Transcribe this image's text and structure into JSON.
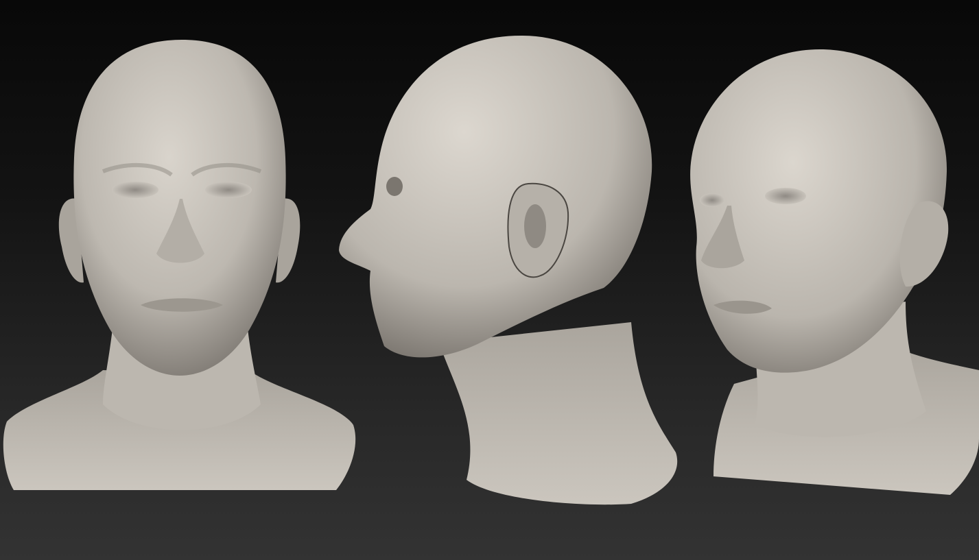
{
  "scene": {
    "background_color": "#1a1a1a",
    "material_color": "#c9c4bc",
    "shadow_color": "#5a5550",
    "views": [
      {
        "id": "front",
        "view": "front"
      },
      {
        "id": "side",
        "view": "left-profile"
      },
      {
        "id": "three-quarter",
        "view": "three-quarter"
      }
    ]
  }
}
